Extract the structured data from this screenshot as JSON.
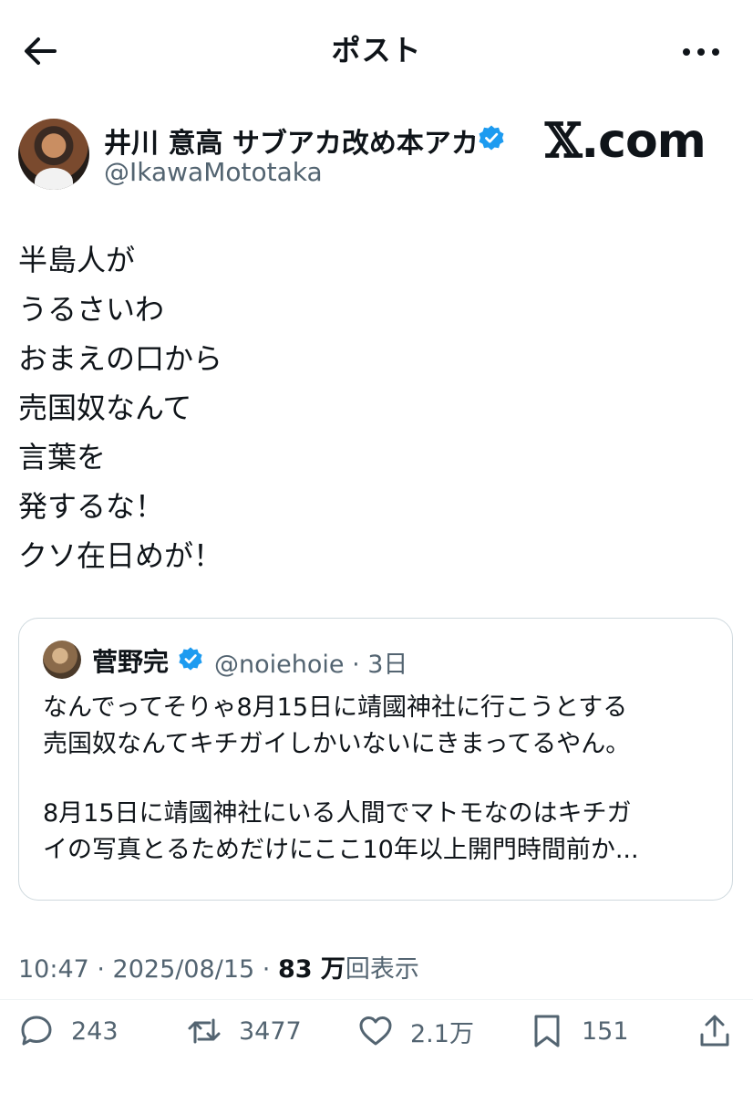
{
  "header": {
    "title": "ポスト",
    "back_icon": "arrow-left-icon",
    "more_icon": "more-horizontal-icon"
  },
  "author": {
    "display_name": "井川 意高 サブアカ改め本アカ",
    "handle": "@IkawaMototaka",
    "verified": true,
    "verified_color": "#1d9bf0"
  },
  "watermark": {
    "x_glyph": "𝕏",
    "suffix": ".com"
  },
  "post": {
    "lines": [
      "半島人が",
      "うるさいわ",
      "おまえの口から",
      "売国奴なんて",
      "言葉を",
      "発するな！",
      "クソ在日めが！"
    ]
  },
  "quote": {
    "name": "菅野完",
    "meta": "@noiehoie · 3日",
    "lines": [
      "なんでってそりゃ8月15日に靖國神社に行こうとする",
      "売国奴なんてキチガイしかいないにきまってるやん。",
      "",
      "8月15日に靖國神社にいる人間でマトモなのはキチガ",
      "イの写真とるためだけにここ10年以上開門時間前か..."
    ]
  },
  "meta": {
    "time": "10:47 · 2025/08/15 · ",
    "views_count": "83 万",
    "views_label": "回表示"
  },
  "actions": {
    "reply": "243",
    "retweet": "3477",
    "like": "2.1万",
    "bookmark": "151",
    "icon_color": "#536471"
  }
}
